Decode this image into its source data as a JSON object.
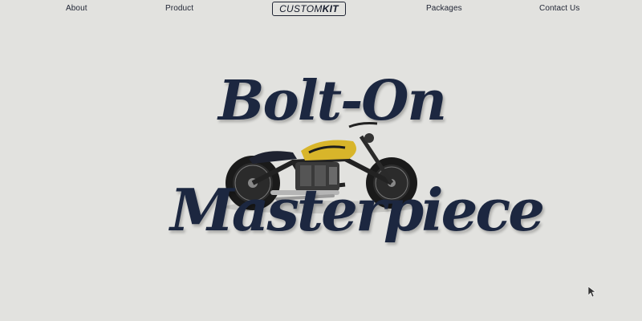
{
  "nav": {
    "about": "About",
    "product": "Product",
    "packages": "Packages",
    "contact": "Contact Us"
  },
  "logo": {
    "part1": "CUSTOM",
    "part2": "KIT"
  },
  "hero": {
    "line1": "Bolt-On",
    "line2": "Masterpiece"
  },
  "colors": {
    "background": "#e2e2df",
    "heading": "#1c2740",
    "tank_accent": "#d8b52a"
  },
  "icons": {
    "motorcycle": "motorcycle-image",
    "cursor": "mouse-pointer-icon"
  }
}
